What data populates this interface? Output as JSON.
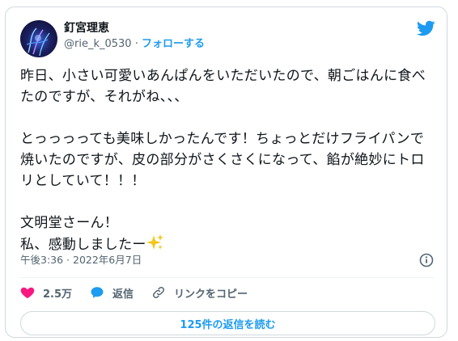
{
  "author": {
    "name": "釘宮理恵",
    "handle": "@rie_k_0530",
    "separator": "·",
    "follow_label": "フォローする",
    "avatar_icon": "avatar-image"
  },
  "brand": {
    "icon": "twitter-bird-icon",
    "color": "#1d9bf0"
  },
  "tweet": {
    "text": "昨日、小さい可愛いあんぱんをいただいたので、朝ごはんに食べたのですが、それがね、、、\n\nとっっっっても美味しかったんです！ちょっとだけフライパンで焼いたのですが、皮の部分がさくさくになって、餡が絶妙にトロリとしていて！！！\n\n文明堂さーん！\n私、感動しましたー",
    "emoji_icon": "sparkles-icon",
    "timestamp": "午後3:36 · 2022年6月7日"
  },
  "actions": {
    "like_count": "2.5万",
    "like_color": "#f91880",
    "reply_label": "返信",
    "copy_link_label": "リンクをコピー"
  },
  "replies_button_label": "125件の返信を読む"
}
